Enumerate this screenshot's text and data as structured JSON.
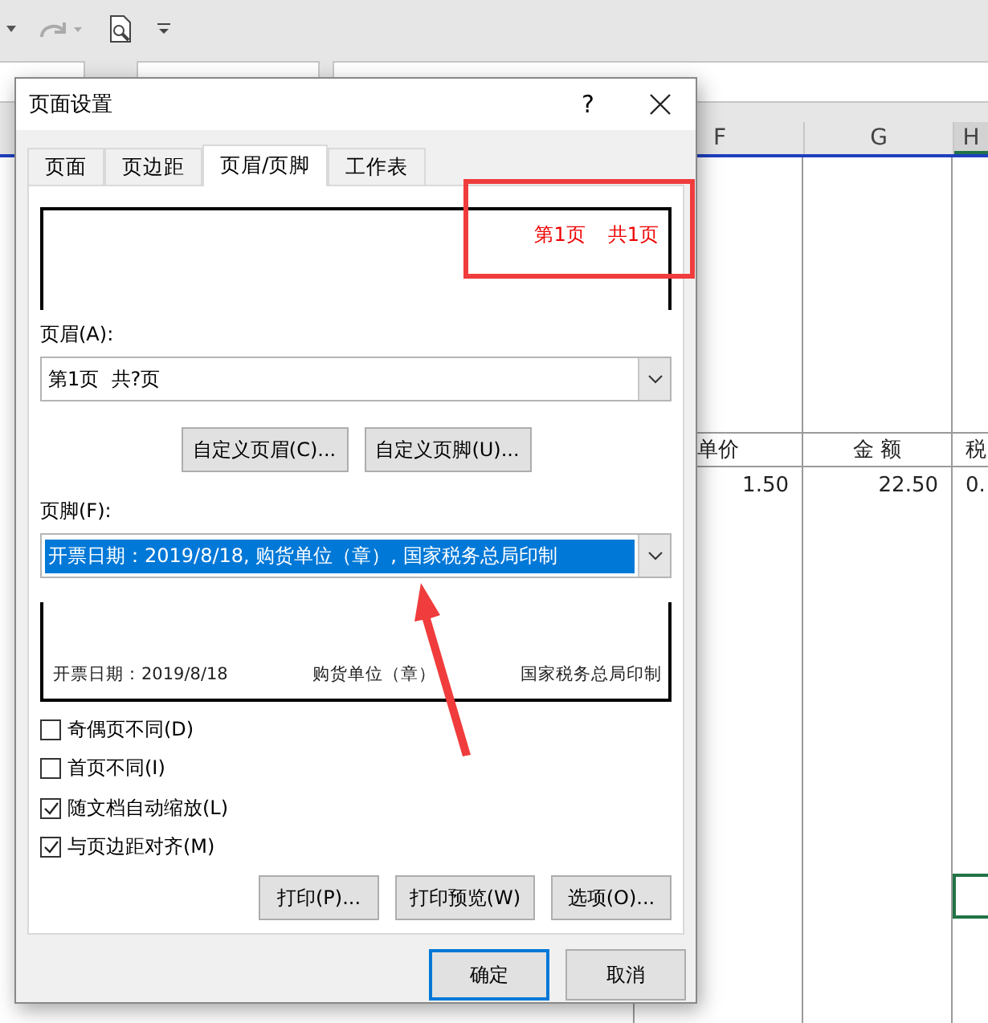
{
  "columns": [
    {
      "label": "F",
      "selected": false
    },
    {
      "label": "G",
      "selected": false
    },
    {
      "label": "H",
      "selected": true
    }
  ],
  "sheet": {
    "headers": [
      "单价",
      "金 额",
      "税"
    ],
    "values": [
      "1.50",
      "22.50",
      "0."
    ]
  },
  "dialog": {
    "title": "页面设置",
    "help": "?",
    "tabs": [
      {
        "label": "页面",
        "selected": false
      },
      {
        "label": "页边距",
        "selected": false
      },
      {
        "label": "页眉/页脚",
        "selected": true
      },
      {
        "label": "工作表",
        "selected": false
      }
    ],
    "header_preview": [
      "第1页",
      "共1页"
    ],
    "header_label": "页眉(A):",
    "header_value": "第1页  共?页",
    "header_highlighted": false,
    "custom_buttons": [
      "自定义页眉(C)...",
      "自定义页脚(U)..."
    ],
    "footer_label": "页脚(F):",
    "footer_value": "开票日期：2019/8/18, 购货单位（章）, 国家税务总局印制",
    "footer_highlighted": true,
    "footer_preview": [
      "开票日期：2019/8/18",
      "购货单位（章）",
      "国家税务总局印制"
    ],
    "checkboxes": [
      {
        "label": "奇偶页不同(D)",
        "checked": false
      },
      {
        "label": "首页不同(I)",
        "checked": false
      },
      {
        "label": "随文档自动缩放(L)",
        "checked": true
      },
      {
        "label": "与页边距对齐(M)",
        "checked": true
      }
    ],
    "action_buttons": [
      "打印(P)...",
      "打印预览(W)",
      "选项(O)..."
    ],
    "ok": "确定",
    "cancel": "取消"
  }
}
